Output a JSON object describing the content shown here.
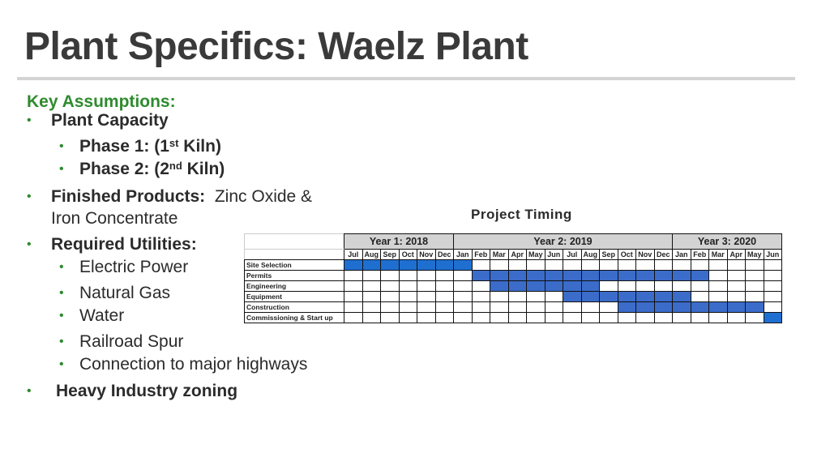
{
  "slide": {
    "title": "Plant Specifics: Waelz Plant",
    "heading": "Key Assumptions:",
    "bullets": {
      "plant_capacity": "Plant Capacity",
      "phase1_prefix": "Phase 1: (1",
      "phase1_sup": "st",
      "phase1_suffix": " Kiln)",
      "phase2_prefix": "Phase 2",
      "phase2_mid": ": (2",
      "phase2_sup": "nd",
      "phase2_suffix": " Kiln)",
      "finished_label": "Finished Products:",
      "finished_value": "  Zinc Oxide &",
      "finished_value2": "Iron Concentrate",
      "utilities_label": "Required Utilities:",
      "utilities": [
        "Electric Power",
        "Natural Gas",
        "Water",
        "Railroad Spur",
        "Connection to major highways"
      ],
      "zoning": "Heavy Industry zoning"
    },
    "bullet_glyph": "•",
    "colors": {
      "heading": "#2e8b2e",
      "bar": "#3b6cc9",
      "bar_bright": "#1f6fd1",
      "year_header": "#d3d3d3"
    }
  },
  "gantt": {
    "title": "Project Timing",
    "years": [
      {
        "label": "Year 1:  2018",
        "span": 6
      },
      {
        "label": "Year 2:  2019",
        "span": 12
      },
      {
        "label": "Year 3:  2020",
        "span": 6
      }
    ],
    "months": [
      "Jul",
      "Aug",
      "Sep",
      "Oct",
      "Nov",
      "Dec",
      "Jan",
      "Feb",
      "Mar",
      "Apr",
      "May",
      "Jun",
      "Jul",
      "Aug",
      "Sep",
      "Oct",
      "Nov",
      "Dec",
      "Jan",
      "Feb",
      "Mar",
      "Apr",
      "May",
      "Jun"
    ],
    "tasks": [
      {
        "name": "Site Selection",
        "start": 0,
        "end": 6,
        "bright": true
      },
      {
        "name": "Permits",
        "start": 7,
        "end": 19,
        "bright": false
      },
      {
        "name": "Engineering",
        "start": 8,
        "end": 13,
        "bright": false
      },
      {
        "name": "Equipment",
        "start": 12,
        "end": 18,
        "bright": false
      },
      {
        "name": "Construction",
        "start": 15,
        "end": 22,
        "bright": false
      },
      {
        "name": "Commissioning & Start up",
        "start": 23,
        "end": 23,
        "bright": true
      }
    ]
  }
}
